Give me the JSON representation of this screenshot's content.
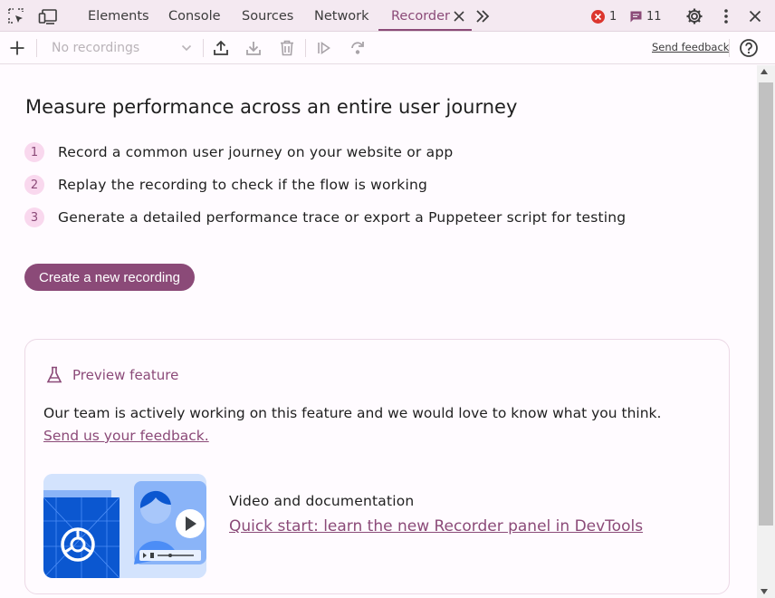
{
  "tabs": [
    {
      "label": "Elements"
    },
    {
      "label": "Console"
    },
    {
      "label": "Sources"
    },
    {
      "label": "Network"
    },
    {
      "label": "Recorder",
      "active": true
    }
  ],
  "errors_count": "1",
  "messages_count": "11",
  "toolbar": {
    "recording_placeholder": "No recordings",
    "send_feedback": "Send feedback"
  },
  "main": {
    "headline": "Measure performance across an entire user journey",
    "steps": [
      {
        "num": "1",
        "text": "Record a common user journey on your website or app"
      },
      {
        "num": "2",
        "text": "Replay the recording to check if the flow is working"
      },
      {
        "num": "3",
        "text": "Generate a detailed performance trace or export a Puppeteer script for testing"
      }
    ],
    "create_button": "Create a new recording"
  },
  "preview": {
    "title": "Preview feature",
    "body": "Our team is actively working on this feature and we would love to know what you think.",
    "feedback_link": "Send us your feedback.",
    "video_label": "Video and documentation",
    "video_link": "Quick start: learn the new Recorder panel in DevTools"
  },
  "colors": {
    "accent": "#8b4a78",
    "tabbar_bg": "#f4e9f1",
    "step_badge_bg": "#f9d8ee",
    "error_red": "#dc362e"
  },
  "icons": [
    "inspect-element-icon",
    "device-toolbar-icon",
    "close-tab-icon",
    "more-tabs-icon",
    "error-icon",
    "message-icon",
    "settings-icon",
    "more-vertical-icon",
    "close-devtools-icon",
    "add-icon",
    "chevron-down-icon",
    "export-icon",
    "download-icon",
    "delete-icon",
    "replay-icon",
    "step-over-icon",
    "help-icon",
    "flask-icon",
    "video-thumbnail"
  ]
}
